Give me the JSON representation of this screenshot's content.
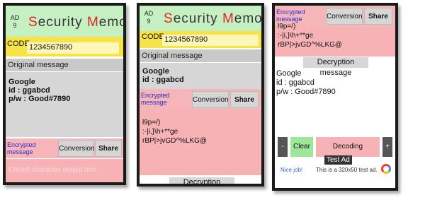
{
  "app": {
    "title_part1": "S",
    "title_part2": "ecurity ",
    "title_part3": "M",
    "title_part4": "emo",
    "ad_label": "AD\n9"
  },
  "screen1": {
    "code_label": "CODE",
    "code_value": "1234567890",
    "original_label": "Original message",
    "memo_line1": "Google",
    "memo_line2": "id : ggabcd",
    "memo_line3": "p/w : Good#7890",
    "encrypted_label": "Encrypted message",
    "conversion_button": "Conversion",
    "share_button": "Share",
    "output_placeholder": "Coded character output box."
  },
  "screen2": {
    "code_label": "CODE",
    "code_value": "1234567890",
    "original_label": "Original message",
    "memo_line1": "Google",
    "memo_line2": "id : ggabcd",
    "encrypted_label": "Encrypted message",
    "conversion_button": "Conversion",
    "share_button": "Share",
    "enc_line1": "l9p=/)",
    "enc_line2": ":-|i,}\\h+**ge",
    "enc_line3": "rBP|>jvGD^%LKG@",
    "decryption_label": "Decryption message"
  },
  "screen3": {
    "encrypted_label": "Encrypted message",
    "conversion_button": "Conversion",
    "share_button": "Share",
    "enc_line0": "l9p=/)",
    "enc_line1": ":-|i,}\\h+**ge",
    "enc_line2": "rBP|>jvGD^%LKG@",
    "decryption_label": "Decryption message",
    "dec_line1": "Google",
    "dec_line2": "id : ggabcd",
    "dec_line3": "p/w : Good#7890",
    "minus_button": "-",
    "clear_button": "Clear",
    "decoding_button": "Decoding",
    "plus_button": "+",
    "ad_nice": "Nice job!",
    "ad_text": "This is a 320x50 test ad.",
    "test_ad_label": "Test Ad"
  }
}
